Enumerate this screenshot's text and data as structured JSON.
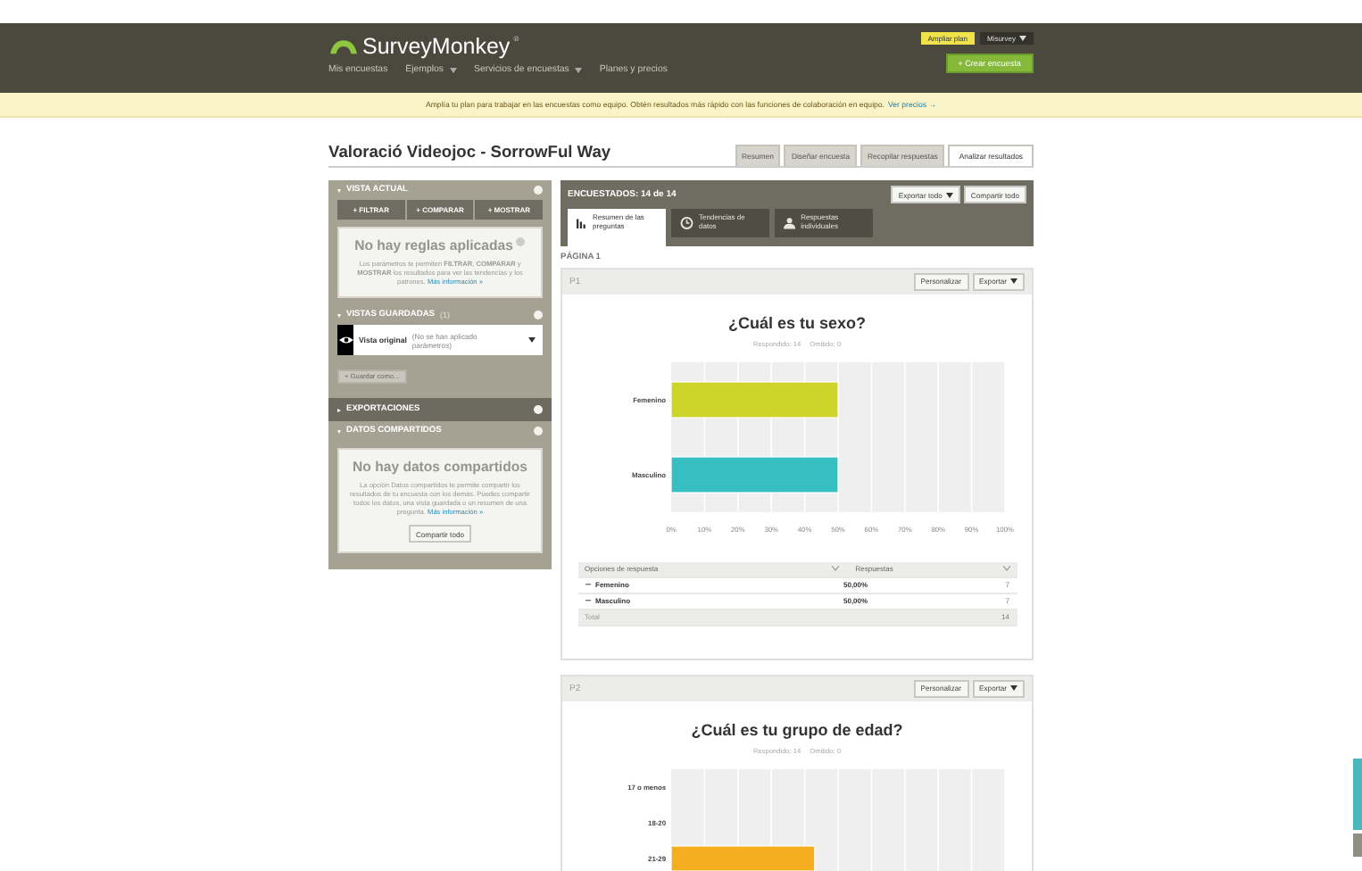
{
  "header": {
    "logo": "SurveyMonkey",
    "logo_mark": "®",
    "upgrade_button": "Ampliar plan",
    "account": "Misurvey",
    "nav": [
      {
        "label": "Mis encuestas",
        "dropdown": false
      },
      {
        "label": "Ejemplos",
        "dropdown": true
      },
      {
        "label": "Servicios de encuestas",
        "dropdown": true
      },
      {
        "label": "Planes y precios",
        "dropdown": false
      }
    ],
    "create_button": "+ Crear encuesta"
  },
  "banner": {
    "text": "Amplía tu plan para trabajar en las encuestas como equipo. Obtén resultados más rápido con las funciones de colaboración en equipo.",
    "link": "Ver precios →"
  },
  "survey_title": "Valoració Videojoc - SorrowFul Way",
  "tabs": [
    {
      "label": "Resumen",
      "selected": false
    },
    {
      "label": "Diseñar encuesta",
      "selected": false
    },
    {
      "label": "Recopilar respuestas",
      "selected": false
    },
    {
      "label": "Analizar resultados",
      "selected": true
    }
  ],
  "sidebar": {
    "current_view": {
      "title": "VISTA ACTUAL",
      "expanded": true,
      "buttons": [
        "+ FILTRAR",
        "+ COMPARAR",
        "+ MOSTRAR"
      ],
      "empty_title": "No hay reglas aplicadas",
      "empty_text": "Los parámetros te permiten **FILTRAR**, **COMPARAR** y **MOSTRAR** los resultados para ver las tendencias y los patrones.",
      "empty_link": "Más información »"
    },
    "saved_views": {
      "title": "VISTAS GUARDADAS",
      "count": "(1)",
      "expanded": true,
      "view_name": "Vista original",
      "view_note": "(No se han aplicado parámetros)",
      "save_button": "+ Guardar como..."
    },
    "exports": {
      "title": "EXPORTACIONES",
      "expanded": false
    },
    "shared_data": {
      "title": "DATOS COMPARTIDOS",
      "expanded": true,
      "empty_title": "No hay datos compartidos",
      "empty_text": "La opción Datos compartidos te permite compartir los resultados de tu encuesta con los demás. Puedes compartir todos los datos, una vista guardada o un resumen de una pregunta.",
      "empty_link": "Más información »",
      "button": "Compartir todo"
    }
  },
  "results": {
    "respondents": "ENCUESTADOS: 14 de 14",
    "export_all": "Exportar todo",
    "share_all": "Compartir todo",
    "views": [
      {
        "label": "Resumen de las preguntas",
        "selected": true
      },
      {
        "label": "Tendencias de datos",
        "selected": false
      },
      {
        "label": "Respuestas individuales",
        "selected": false
      }
    ],
    "page_label": "PÁGINA 1",
    "questions": [
      {
        "number": "P1",
        "customize": "Personalizar",
        "export": "Exportar",
        "title": "¿Cuál es tu sexo?",
        "answered": "Respondido: 14",
        "skipped": "Omitido: 0",
        "chart_data": {
          "type": "bar",
          "orientation": "horizontal",
          "grid": true,
          "categories": [
            "Femenino",
            "Masculino"
          ],
          "xlim": [
            0,
            100
          ],
          "series": [
            {
              "color": "#cdd52a",
              "values": [
                50,
                null
              ]
            },
            {
              "color": "#35bfc1",
              "values": [
                null,
                50
              ]
            }
          ],
          "xticks": [
            {
              "value": 0,
              "label": "0%"
            },
            {
              "value": 10,
              "label": "10%"
            },
            {
              "value": 20,
              "label": "20%"
            },
            {
              "value": 30,
              "label": "30%"
            },
            {
              "value": 40,
              "label": "40%"
            },
            {
              "value": 50,
              "label": "50%"
            },
            {
              "value": 60,
              "label": "60%"
            },
            {
              "value": 70,
              "label": "70%"
            },
            {
              "value": 80,
              "label": "80%"
            },
            {
              "value": 90,
              "label": "90%"
            },
            {
              "value": 100,
              "label": "100%"
            }
          ]
        },
        "table": {
          "columns": [
            "Opciones de respuesta",
            "Respuestas"
          ],
          "rows": [
            {
              "option": "Femenino",
              "percent": "50,00%",
              "count": "7"
            },
            {
              "option": "Masculino",
              "percent": "50,00%",
              "count": "7"
            }
          ],
          "total_label": "Total",
          "total": "14"
        }
      },
      {
        "number": "P2",
        "customize": "Personalizar",
        "export": "Exportar",
        "title": "¿Cuál es tu grupo de edad?",
        "answered": "Respondido: 14",
        "skipped": "Omitido: 0",
        "chart_data": {
          "type": "bar",
          "orientation": "horizontal",
          "grid": true,
          "categories": [
            "17 o menos",
            "18-20",
            "21-29"
          ],
          "xlim": [
            0,
            100
          ],
          "series": [
            {
              "color": "#f5ae1f",
              "values": [
                0,
                0,
                43
              ]
            }
          ]
        }
      }
    ]
  }
}
